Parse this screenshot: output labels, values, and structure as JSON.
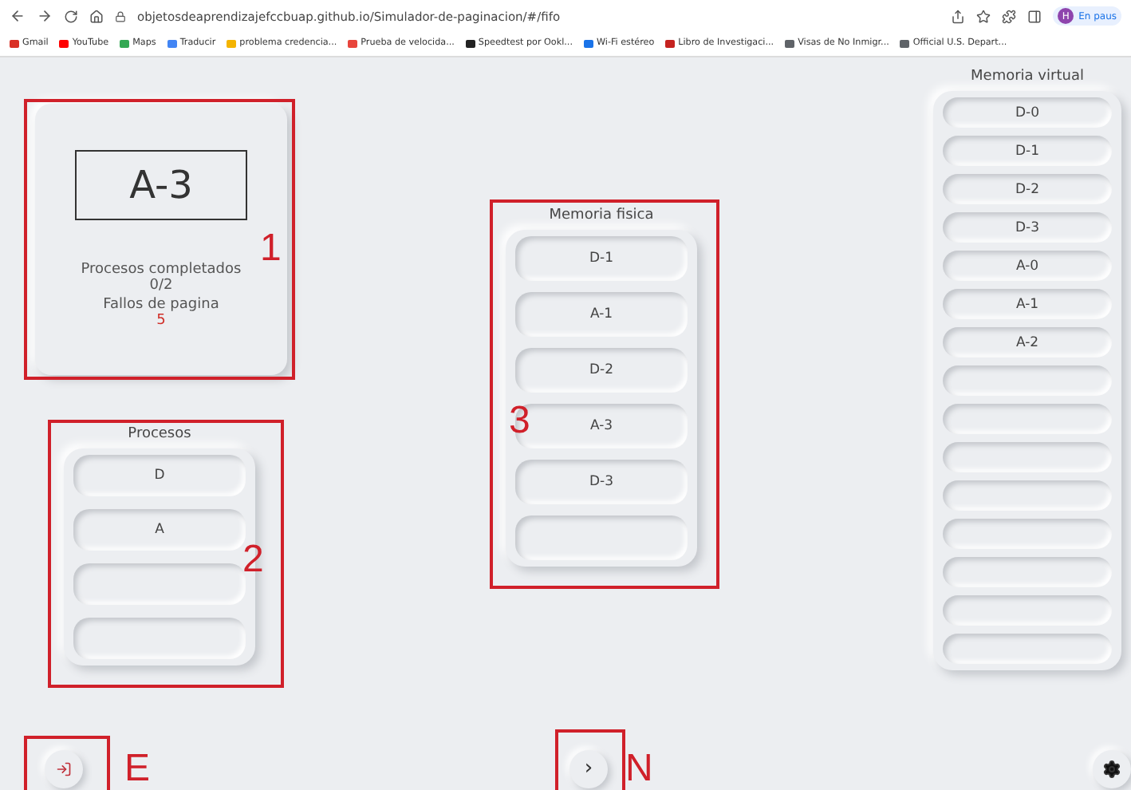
{
  "browser": {
    "address": "objetosdeaprendizajefccbuap.github.io/Simulador-de-paginacion/#/fifo",
    "profile_initial": "H",
    "profile_status": "En paus",
    "bookmarks": [
      {
        "label": "Gmail",
        "color": "#d93025"
      },
      {
        "label": "YouTube",
        "color": "#ff0000"
      },
      {
        "label": "Maps",
        "color": "#34a853"
      },
      {
        "label": "Traducir",
        "color": "#4285f4"
      },
      {
        "label": "problema credencia...",
        "color": "#f4b400"
      },
      {
        "label": "Prueba de velocida...",
        "color": "#e8453c"
      },
      {
        "label": "Speedtest por Ookl...",
        "color": "#222222"
      },
      {
        "label": "Wi-Fi estéreo",
        "color": "#1a73e8"
      },
      {
        "label": "Libro de Investigaci...",
        "color": "#c5221f"
      },
      {
        "label": "Visas de No Inmigr...",
        "color": "#5f6368"
      },
      {
        "label": "Official U.S. Depart...",
        "color": "#5f6368"
      }
    ]
  },
  "status_card": {
    "annotation": "1",
    "current_page": "A-3",
    "stats": [
      {
        "label": "Procesos completados",
        "value": "0/2",
        "alert": false
      },
      {
        "label": "Fallos de pagina",
        "value": "5",
        "alert": true
      }
    ]
  },
  "processes": {
    "annotation": "2",
    "title": "Procesos",
    "slots": [
      {
        "kind": "filled",
        "label": "D"
      },
      {
        "kind": "filled",
        "label": "A"
      },
      {
        "kind": "empty"
      },
      {
        "kind": "empty"
      }
    ]
  },
  "physical_memory": {
    "annotation": "3",
    "title": "Memoria fisica",
    "slots": [
      {
        "kind": "filled",
        "label": "D-1"
      },
      {
        "kind": "filled",
        "label": "A-1"
      },
      {
        "kind": "filled",
        "label": "D-2"
      },
      {
        "kind": "filled",
        "label": "A-3"
      },
      {
        "kind": "filled",
        "label": "D-3"
      },
      {
        "kind": "empty"
      }
    ]
  },
  "virtual_memory": {
    "title": "Memoria virtual",
    "slots": [
      {
        "kind": "filled",
        "label": "D-0"
      },
      {
        "kind": "filled",
        "label": "D-1"
      },
      {
        "kind": "filled",
        "label": "D-2"
      },
      {
        "kind": "filled",
        "label": "D-3"
      },
      {
        "kind": "filled",
        "label": "A-0"
      },
      {
        "kind": "filled",
        "label": "A-1"
      },
      {
        "kind": "filled",
        "label": "A-2"
      },
      {
        "kind": "empty"
      },
      {
        "kind": "empty"
      },
      {
        "kind": "empty"
      },
      {
        "kind": "empty"
      },
      {
        "kind": "empty"
      },
      {
        "kind": "empty"
      },
      {
        "kind": "empty"
      },
      {
        "kind": "empty"
      }
    ]
  },
  "footer": {
    "exit_annotation": "E",
    "next_annotation": "N",
    "next_symbol": "›"
  }
}
